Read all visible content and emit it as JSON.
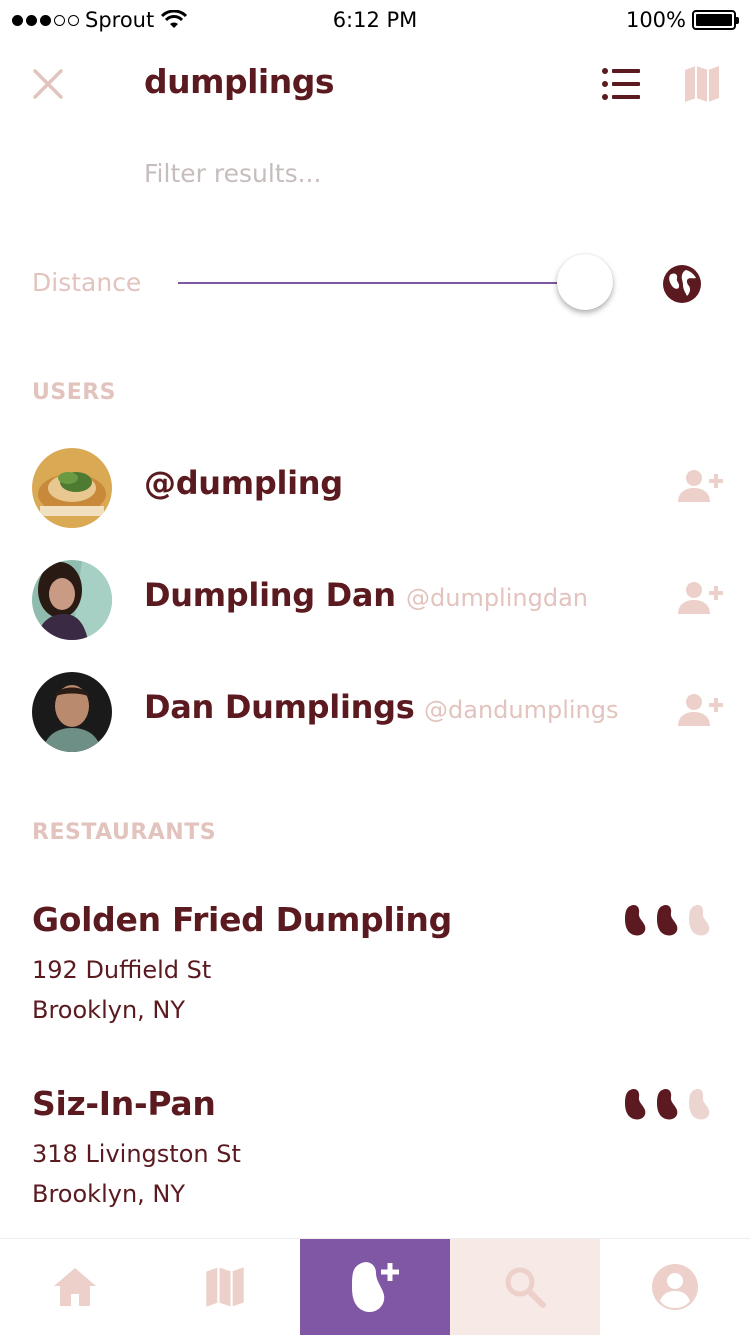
{
  "status_bar": {
    "carrier": "Sprout",
    "time": "6:12 PM",
    "battery": "100%",
    "signal_dots_filled": 3,
    "signal_dots_total": 5
  },
  "header": {
    "title": "dumplings",
    "close_icon": "close-icon",
    "list_icon": "list-view-icon",
    "map_icon": "map-view-icon"
  },
  "filter": {
    "placeholder": "Filter results...",
    "value": ""
  },
  "distance": {
    "label": "Distance",
    "level": 1.0,
    "globe_icon": "globe-icon"
  },
  "users_section": {
    "title": "USERS",
    "items": [
      {
        "name": "@dumpling",
        "handle": ""
      },
      {
        "name": "Dumpling Dan",
        "handle": "@dumplingdan"
      },
      {
        "name": "Dan Dumplings",
        "handle": "@dandumplings"
      }
    ]
  },
  "restaurants_section": {
    "title": "RESTAURANTS",
    "items": [
      {
        "name": "Golden Fried Dumpling",
        "address_line1": "192 Duffield St",
        "address_line2": "Brooklyn, NY",
        "rating": 2,
        "rating_max": 3
      },
      {
        "name": "Siz-In-Pan",
        "address_line1": "318 Livingston St",
        "address_line2": "Brooklyn, NY",
        "rating": 2,
        "rating_max": 3
      }
    ]
  },
  "tab_bar": {
    "tabs": [
      {
        "icon": "home-icon",
        "active": false
      },
      {
        "icon": "map-icon",
        "active": false
      },
      {
        "icon": "add-bean-icon",
        "active": true
      },
      {
        "icon": "search-icon",
        "active": true
      },
      {
        "icon": "profile-icon",
        "active": false
      }
    ]
  },
  "colors": {
    "primary_text": "#5a1a1f",
    "muted_text": "#e2c3bd",
    "accent_purple": "#7f57a4",
    "search_tab_bg": "#f6e9e6",
    "bean_filled": "#5a1a1f",
    "bean_empty": "#ecd5d0"
  }
}
